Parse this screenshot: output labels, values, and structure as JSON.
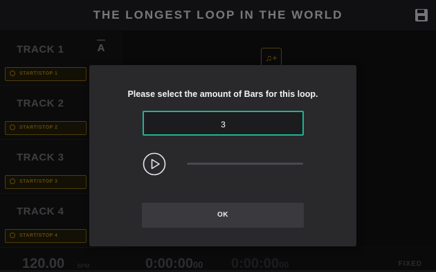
{
  "header": {
    "title": "THE LONGEST LOOP IN THE WORLD",
    "save_icon": "floppy-save-icon"
  },
  "tracks": [
    {
      "name": "TRACK 1",
      "indicator": "A",
      "button_label": "START/STOP 1"
    },
    {
      "name": "TRACK 2",
      "button_label": "START/STOP 2"
    },
    {
      "name": "TRACK 3",
      "button_label": "START/STOP 3"
    },
    {
      "name": "TRACK 4",
      "button_label": "START/STOP 4"
    }
  ],
  "main": {
    "loop_icon": "loop-add-icon",
    "loop_icon_glyph": "♫+"
  },
  "footer": {
    "bpm": "120.00",
    "bpm_unit": "BPM",
    "time_elapsed": "0:00:00",
    "time_elapsed_ms": "00",
    "time_total": "0:00:00",
    "time_total_ms": "00",
    "mode": "FIXED"
  },
  "dialog": {
    "prompt": "Please select the amount of Bars for this loop.",
    "bars_value": "3",
    "preview_progress": 0,
    "ok_label": "OK"
  },
  "colors": {
    "accent_teal": "#20b394",
    "accent_amber": "#a87f12",
    "background": "#141416"
  }
}
